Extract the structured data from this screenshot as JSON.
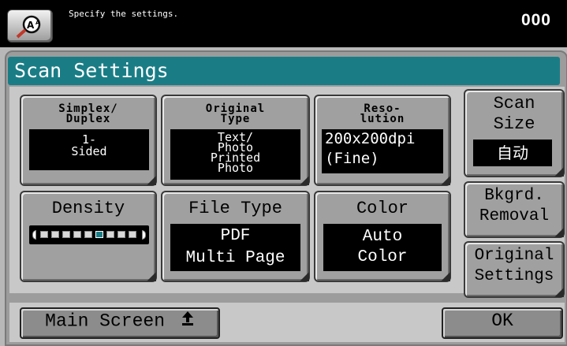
{
  "header": {
    "message": "Specify the settings.",
    "counter": "000",
    "icon": "magnifier-accessibility-icon"
  },
  "title": "Scan Settings",
  "buttons": {
    "simplex_duplex": {
      "label1": "Simplex/",
      "label2": "Duplex",
      "value1": "1-",
      "value2": "Sided"
    },
    "original_type": {
      "label1": "Original",
      "label2": "Type",
      "value1": "Text/",
      "value2": "Photo",
      "value3": "Printed",
      "value4": "Photo"
    },
    "resolution": {
      "label1": "Reso-",
      "label2": "lution",
      "value1": "200x200dpi",
      "value2": "(Fine)"
    },
    "scan_size": {
      "label1": "Scan",
      "label2": "Size",
      "value": "自动"
    },
    "density": {
      "label": "Density",
      "level": 6,
      "max": 10
    },
    "file_type": {
      "label": "File Type",
      "value1": "PDF",
      "value2": "Multi Page"
    },
    "color": {
      "label": "Color",
      "value1": "Auto",
      "value2": "Color"
    },
    "bkgrd_removal": {
      "label1": "Bkgrd.",
      "label2": "Removal"
    },
    "original_settings": {
      "label1": "Original",
      "label2": "Settings"
    }
  },
  "footer": {
    "main_screen": "Main Screen",
    "ok": "OK"
  },
  "colors": {
    "accent": "#1a7d86",
    "background": "#c8c8c8"
  }
}
